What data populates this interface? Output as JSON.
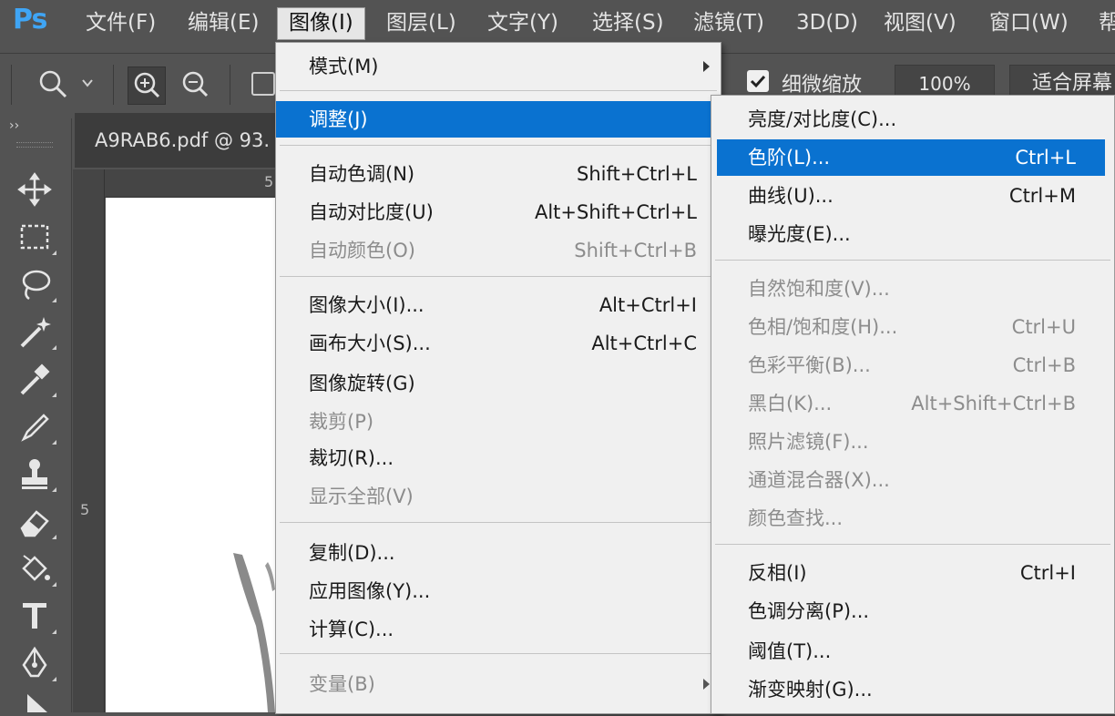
{
  "app": {
    "logo": "Ps"
  },
  "menubar": [
    {
      "label": "文件(F)"
    },
    {
      "label": "编辑(E)"
    },
    {
      "label": "图像(I)"
    },
    {
      "label": "图层(L)"
    },
    {
      "label": "文字(Y)"
    },
    {
      "label": "选择(S)"
    },
    {
      "label": "滤镜(T)"
    },
    {
      "label": "3D(D)"
    },
    {
      "label": "视图(V)"
    },
    {
      "label": "窗口(W)"
    },
    {
      "label": "帮"
    }
  ],
  "options": {
    "scrubby_zoom_label": "细微缩放",
    "scrubby_zoom_checked": true,
    "zoom_percent": "100%",
    "fit_screen": "适合屏幕"
  },
  "document": {
    "tab_title": "A9RAB6.pdf @ 93.",
    "ruler_top_label": "5",
    "ruler_left_label": "5"
  },
  "image_menu": {
    "items": [
      {
        "label": "模式(M)",
        "shortcut": "",
        "disabled": false
      },
      {
        "label": "调整(J)",
        "shortcut": "",
        "disabled": false
      },
      {
        "label": "自动色调(N)",
        "shortcut": "Shift+Ctrl+L",
        "disabled": false
      },
      {
        "label": "自动对比度(U)",
        "shortcut": "Alt+Shift+Ctrl+L",
        "disabled": false
      },
      {
        "label": "自动颜色(O)",
        "shortcut": "Shift+Ctrl+B",
        "disabled": true
      },
      {
        "label": "图像大小(I)...",
        "shortcut": "Alt+Ctrl+I",
        "disabled": false
      },
      {
        "label": "画布大小(S)...",
        "shortcut": "Alt+Ctrl+C",
        "disabled": false
      },
      {
        "label": "图像旋转(G)",
        "shortcut": "",
        "disabled": false
      },
      {
        "label": "裁剪(P)",
        "shortcut": "",
        "disabled": true
      },
      {
        "label": "裁切(R)...",
        "shortcut": "",
        "disabled": false
      },
      {
        "label": "显示全部(V)",
        "shortcut": "",
        "disabled": true
      },
      {
        "label": "复制(D)...",
        "shortcut": "",
        "disabled": false
      },
      {
        "label": "应用图像(Y)...",
        "shortcut": "",
        "disabled": false
      },
      {
        "label": "计算(C)...",
        "shortcut": "",
        "disabled": false
      },
      {
        "label": "变量(B)",
        "shortcut": "",
        "disabled": true
      }
    ]
  },
  "adjust_menu": {
    "items": [
      {
        "label": "亮度/对比度(C)...",
        "shortcut": "",
        "disabled": false
      },
      {
        "label": "色阶(L)...",
        "shortcut": "Ctrl+L",
        "disabled": false
      },
      {
        "label": "曲线(U)...",
        "shortcut": "Ctrl+M",
        "disabled": false
      },
      {
        "label": "曝光度(E)...",
        "shortcut": "",
        "disabled": false
      },
      {
        "label": "自然饱和度(V)...",
        "shortcut": "",
        "disabled": true
      },
      {
        "label": "色相/饱和度(H)...",
        "shortcut": "Ctrl+U",
        "disabled": true
      },
      {
        "label": "色彩平衡(B)...",
        "shortcut": "Ctrl+B",
        "disabled": true
      },
      {
        "label": "黑白(K)...",
        "shortcut": "Alt+Shift+Ctrl+B",
        "disabled": true
      },
      {
        "label": "照片滤镜(F)...",
        "shortcut": "",
        "disabled": true
      },
      {
        "label": "通道混合器(X)...",
        "shortcut": "",
        "disabled": true
      },
      {
        "label": "颜色查找...",
        "shortcut": "",
        "disabled": true
      },
      {
        "label": "反相(I)",
        "shortcut": "Ctrl+I",
        "disabled": false
      },
      {
        "label": "色调分离(P)...",
        "shortcut": "",
        "disabled": false
      },
      {
        "label": "阈值(T)...",
        "shortcut": "",
        "disabled": false
      },
      {
        "label": "渐变映射(G)...",
        "shortcut": "",
        "disabled": false
      }
    ]
  },
  "tools": [
    {
      "icon": "move-icon"
    },
    {
      "icon": "rectangular-marquee-icon"
    },
    {
      "icon": "lasso-icon"
    },
    {
      "icon": "magic-wand-icon"
    },
    {
      "icon": "eyedropper-icon"
    },
    {
      "icon": "brush-icon"
    },
    {
      "icon": "clone-stamp-icon"
    },
    {
      "icon": "eraser-icon"
    },
    {
      "icon": "paint-bucket-icon"
    },
    {
      "icon": "type-icon"
    },
    {
      "icon": "pen-icon"
    },
    {
      "icon": "path-selection-icon"
    }
  ],
  "colors": {
    "highlight": "#0a72d0",
    "menu_bg": "#f0f0f0",
    "ui_bg": "#535353",
    "logo": "#3fa5f5"
  }
}
